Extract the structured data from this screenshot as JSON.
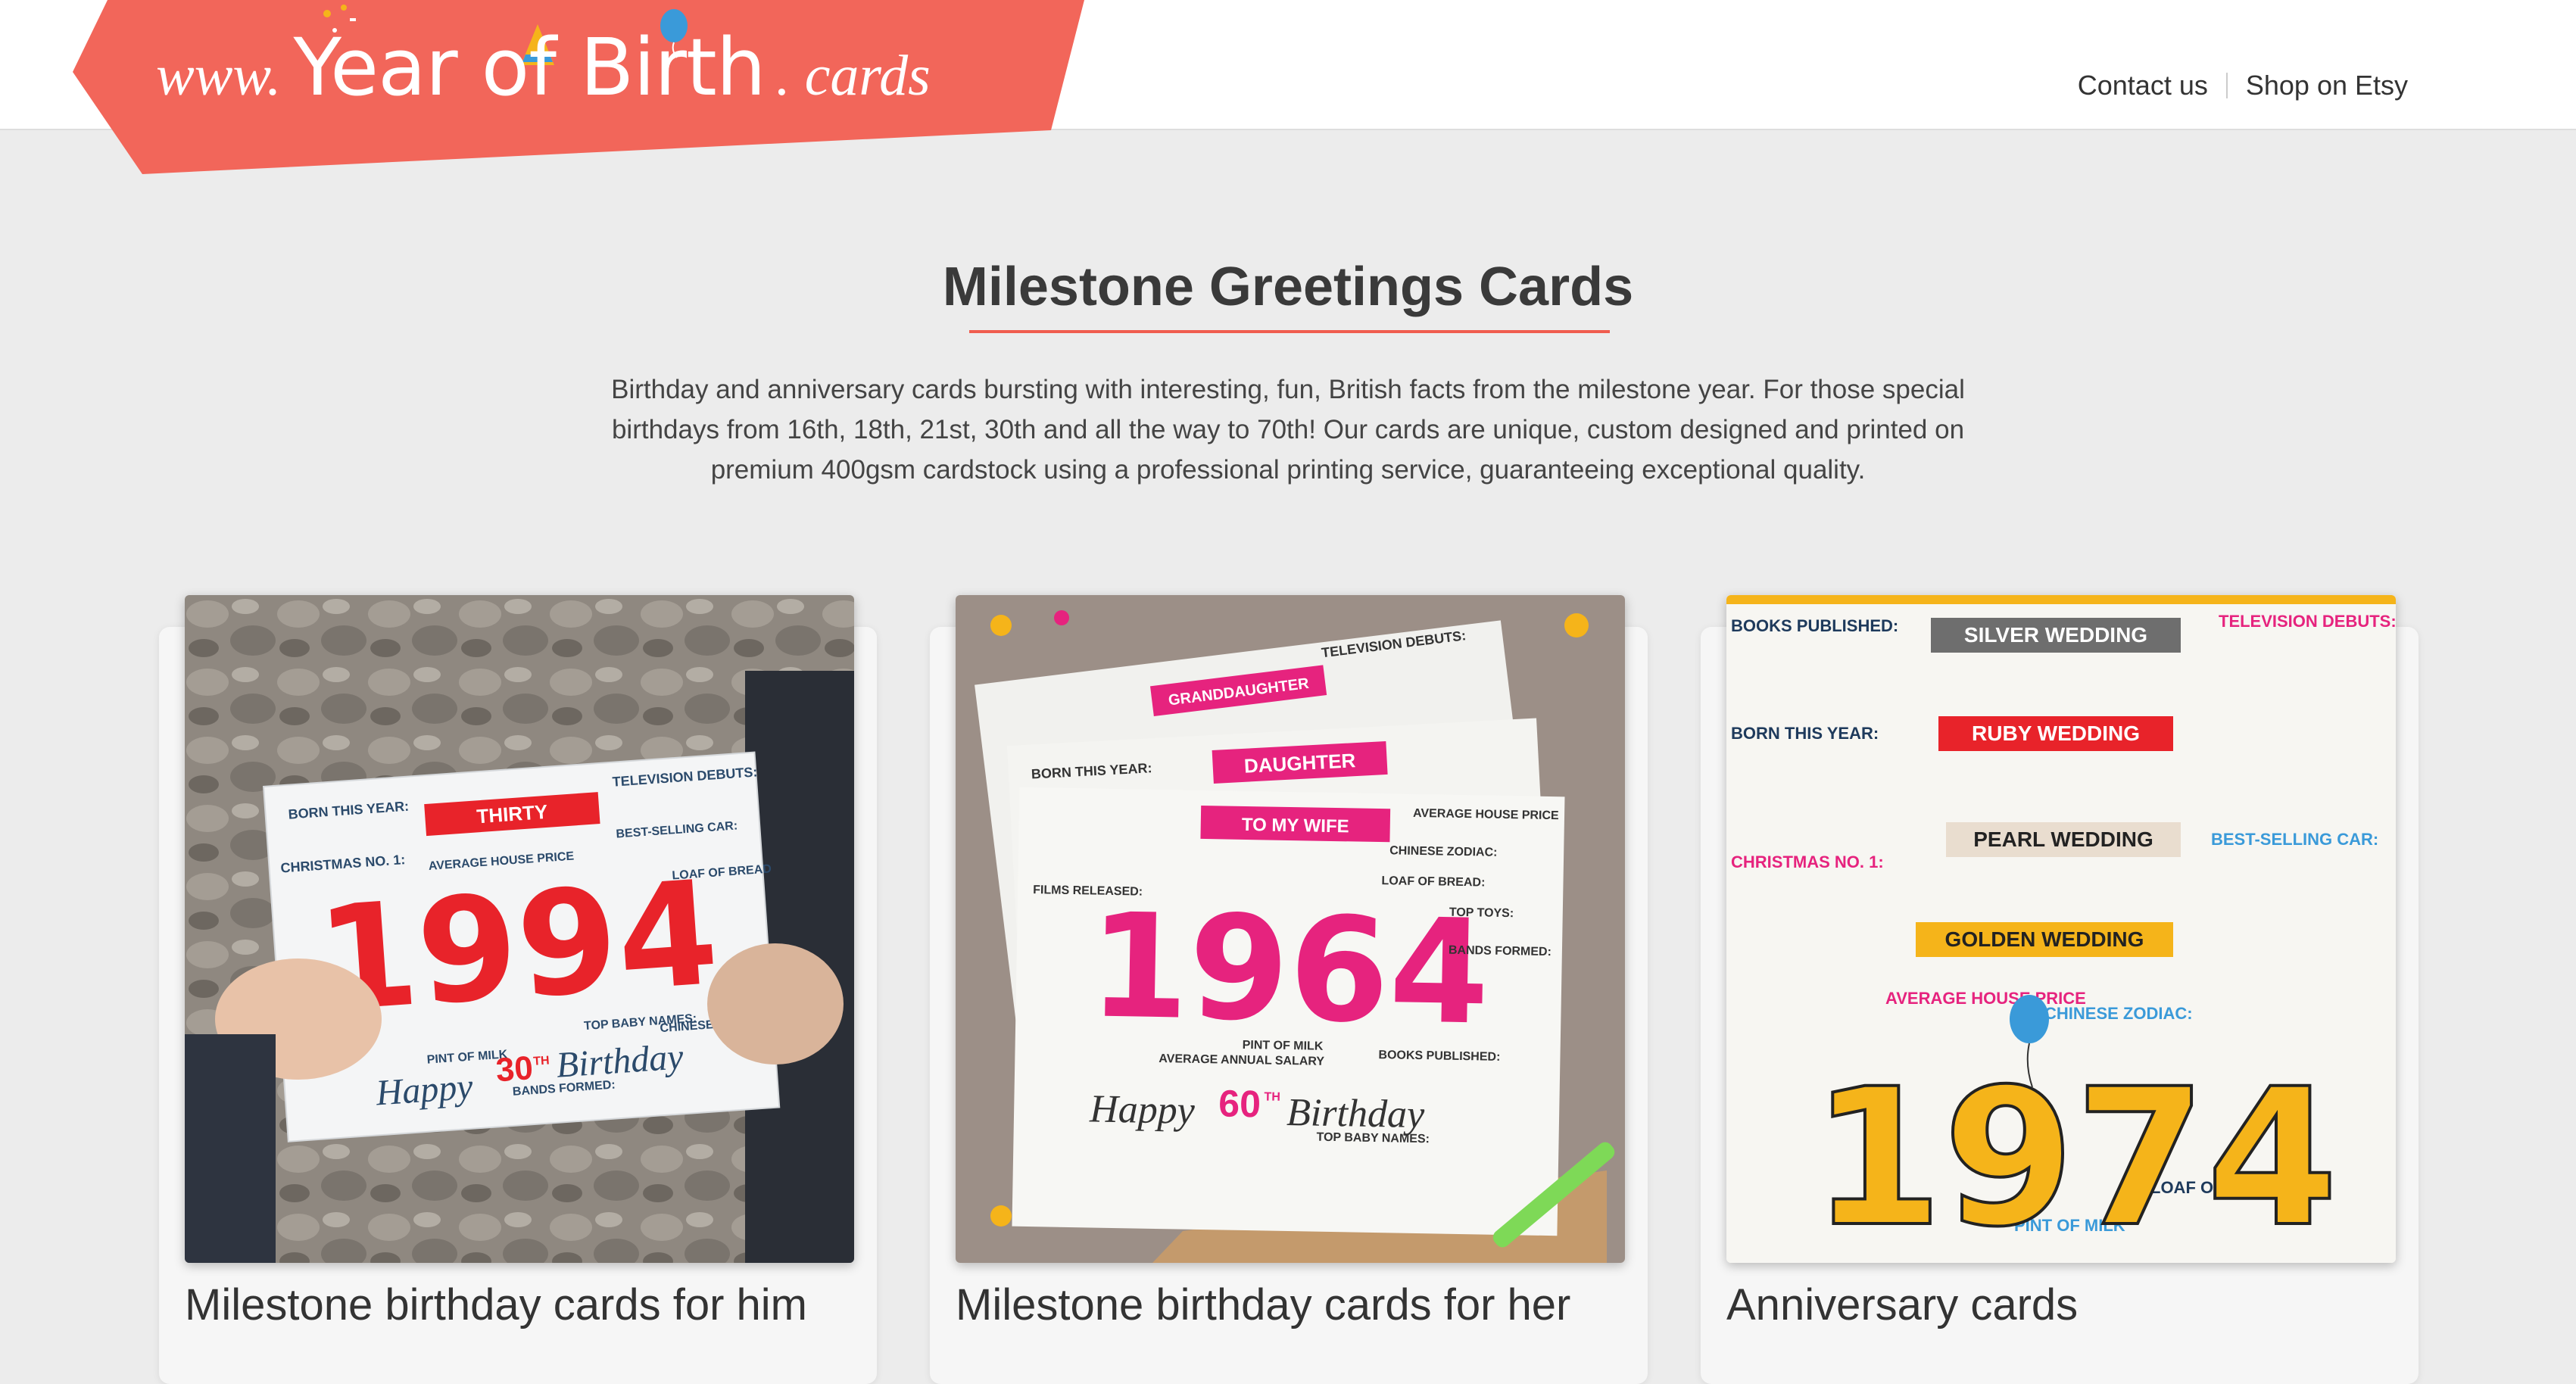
{
  "header": {
    "logo": {
      "www": "www.",
      "main": "Year of Birth",
      "cards": ". cards"
    },
    "nav": [
      {
        "label": "Contact us"
      },
      {
        "label": "Shop on Etsy"
      }
    ]
  },
  "main": {
    "title": "Milestone Greetings Cards",
    "intro": "Birthday and anniversary cards bursting with interesting, fun, British facts from the milestone year. For those special birthdays from 16th, 18th, 21st, 30th and all the way to 70th! Our cards are unique, custom designed and printed on premium 400gsm cardstock using a professional printing service, guaranteeing exceptional quality."
  },
  "cards": [
    {
      "label": "Milestone birthday cards for him",
      "year": "1994",
      "ribbon": "THIRTY",
      "greeting_pre": "Happy",
      "greeting_num": "30",
      "greeting_sup": "TH",
      "greeting_post": "Birthday",
      "facts": [
        "BORN THIS YEAR:",
        "TELEVISION DEBUTS:",
        "CHRISTMAS NO. 1:",
        "AVERAGE HOUSE PRICE",
        "BEST-SELLING CAR:",
        "LOAF OF BREAD",
        "TOP BABY NAMES:",
        "CHINESE ZODIAC:",
        "BANDS FORMED:",
        "PINT OF MILK"
      ]
    },
    {
      "label": "Milestone birthday cards for her",
      "year": "1964",
      "ribbons": [
        "GRANDDAUGHTER",
        "DAUGHTER",
        "TO MY WIFE"
      ],
      "greeting_pre": "Happy",
      "greeting_num": "60",
      "greeting_sup": "TH",
      "greeting_post": "Birthday",
      "facts": [
        "TELEVISION DEBUTS:",
        "BORN THIS YEAR:",
        "AVERAGE HOUSE PRICE",
        "CHINESE ZODIAC:",
        "LOAF OF BREAD:",
        "FILMS RELEASED:",
        "BOOKS PUBLISHED:",
        "TOP BABY NAMES:",
        "PINT OF MILK",
        "AVERAGE ANNUAL SALARY",
        "TOP TOYS:",
        "BANDS FORMED:"
      ]
    },
    {
      "label": "Anniversary cards",
      "year": "1974",
      "ribbons": [
        "SILVER WEDDING",
        "RUBY WEDDING",
        "PEARL WEDDING",
        "GOLDEN WEDDING"
      ],
      "facts": [
        "BOOKS PUBLISHED:",
        "TELEVISION DEBUTS:",
        "BORN THIS YEAR:",
        "CHRISTMAS NO. 1:",
        "AVERAGE HOUSE PRICE",
        "CHINESE ZODIAC:",
        "LOAF OF BREAD",
        "PINT OF MILK",
        "BEST-SELLING CAR:"
      ]
    }
  ],
  "colors": {
    "brand": "#f2665a",
    "underline": "#f05d4f",
    "card1_year": "#e8232a",
    "card2_year": "#e6237e",
    "card3_year": "#f5b41a"
  },
  "icons": [
    "balloon-icon",
    "party-hat-icon"
  ]
}
